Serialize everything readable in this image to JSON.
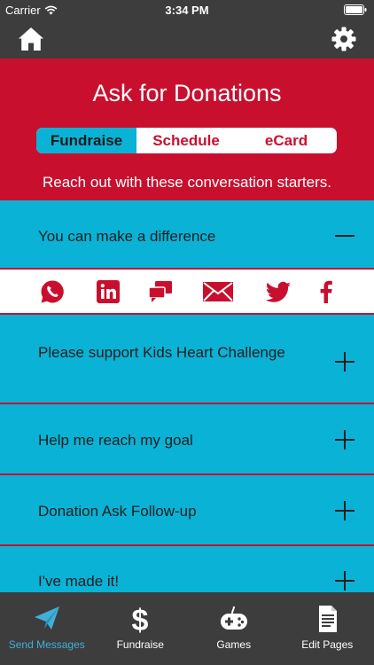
{
  "status_bar": {
    "carrier": "Carrier",
    "time": "3:34 PM"
  },
  "nav": {
    "home_icon": "home-icon",
    "settings_icon": "gear-icon"
  },
  "header": {
    "title": "Ask for Donations",
    "segments": [
      {
        "label": "Fundraise",
        "selected": true
      },
      {
        "label": "Schedule",
        "selected": false
      },
      {
        "label": "eCard",
        "selected": false
      }
    ],
    "subtitle": "Reach out with these conversation starters."
  },
  "messages": [
    {
      "label": "You can make a difference",
      "expanded": true
    },
    {
      "label": "Please support Kids Heart Challenge",
      "expanded": false
    },
    {
      "label": "Help me reach my goal",
      "expanded": false
    },
    {
      "label": "Donation Ask Follow-up",
      "expanded": false
    },
    {
      "label": "I've made it!",
      "expanded": false
    }
  ],
  "share_icons": [
    "whatsapp-icon",
    "linkedin-icon",
    "message-icon",
    "email-icon",
    "twitter-icon",
    "facebook-icon"
  ],
  "tabs": [
    {
      "label": "Send Messages",
      "icon": "paper-plane-icon",
      "active": true
    },
    {
      "label": "Fundraise",
      "icon": "dollar-icon",
      "active": false
    },
    {
      "label": "Games",
      "icon": "gamepad-icon",
      "active": false
    },
    {
      "label": "Edit Pages",
      "icon": "document-icon",
      "active": false
    }
  ],
  "colors": {
    "brand_red": "#c8102e",
    "accent_blue": "#0ab2d6",
    "bar_gray": "#3d3d3d",
    "active_tab": "#3fb1d9"
  }
}
